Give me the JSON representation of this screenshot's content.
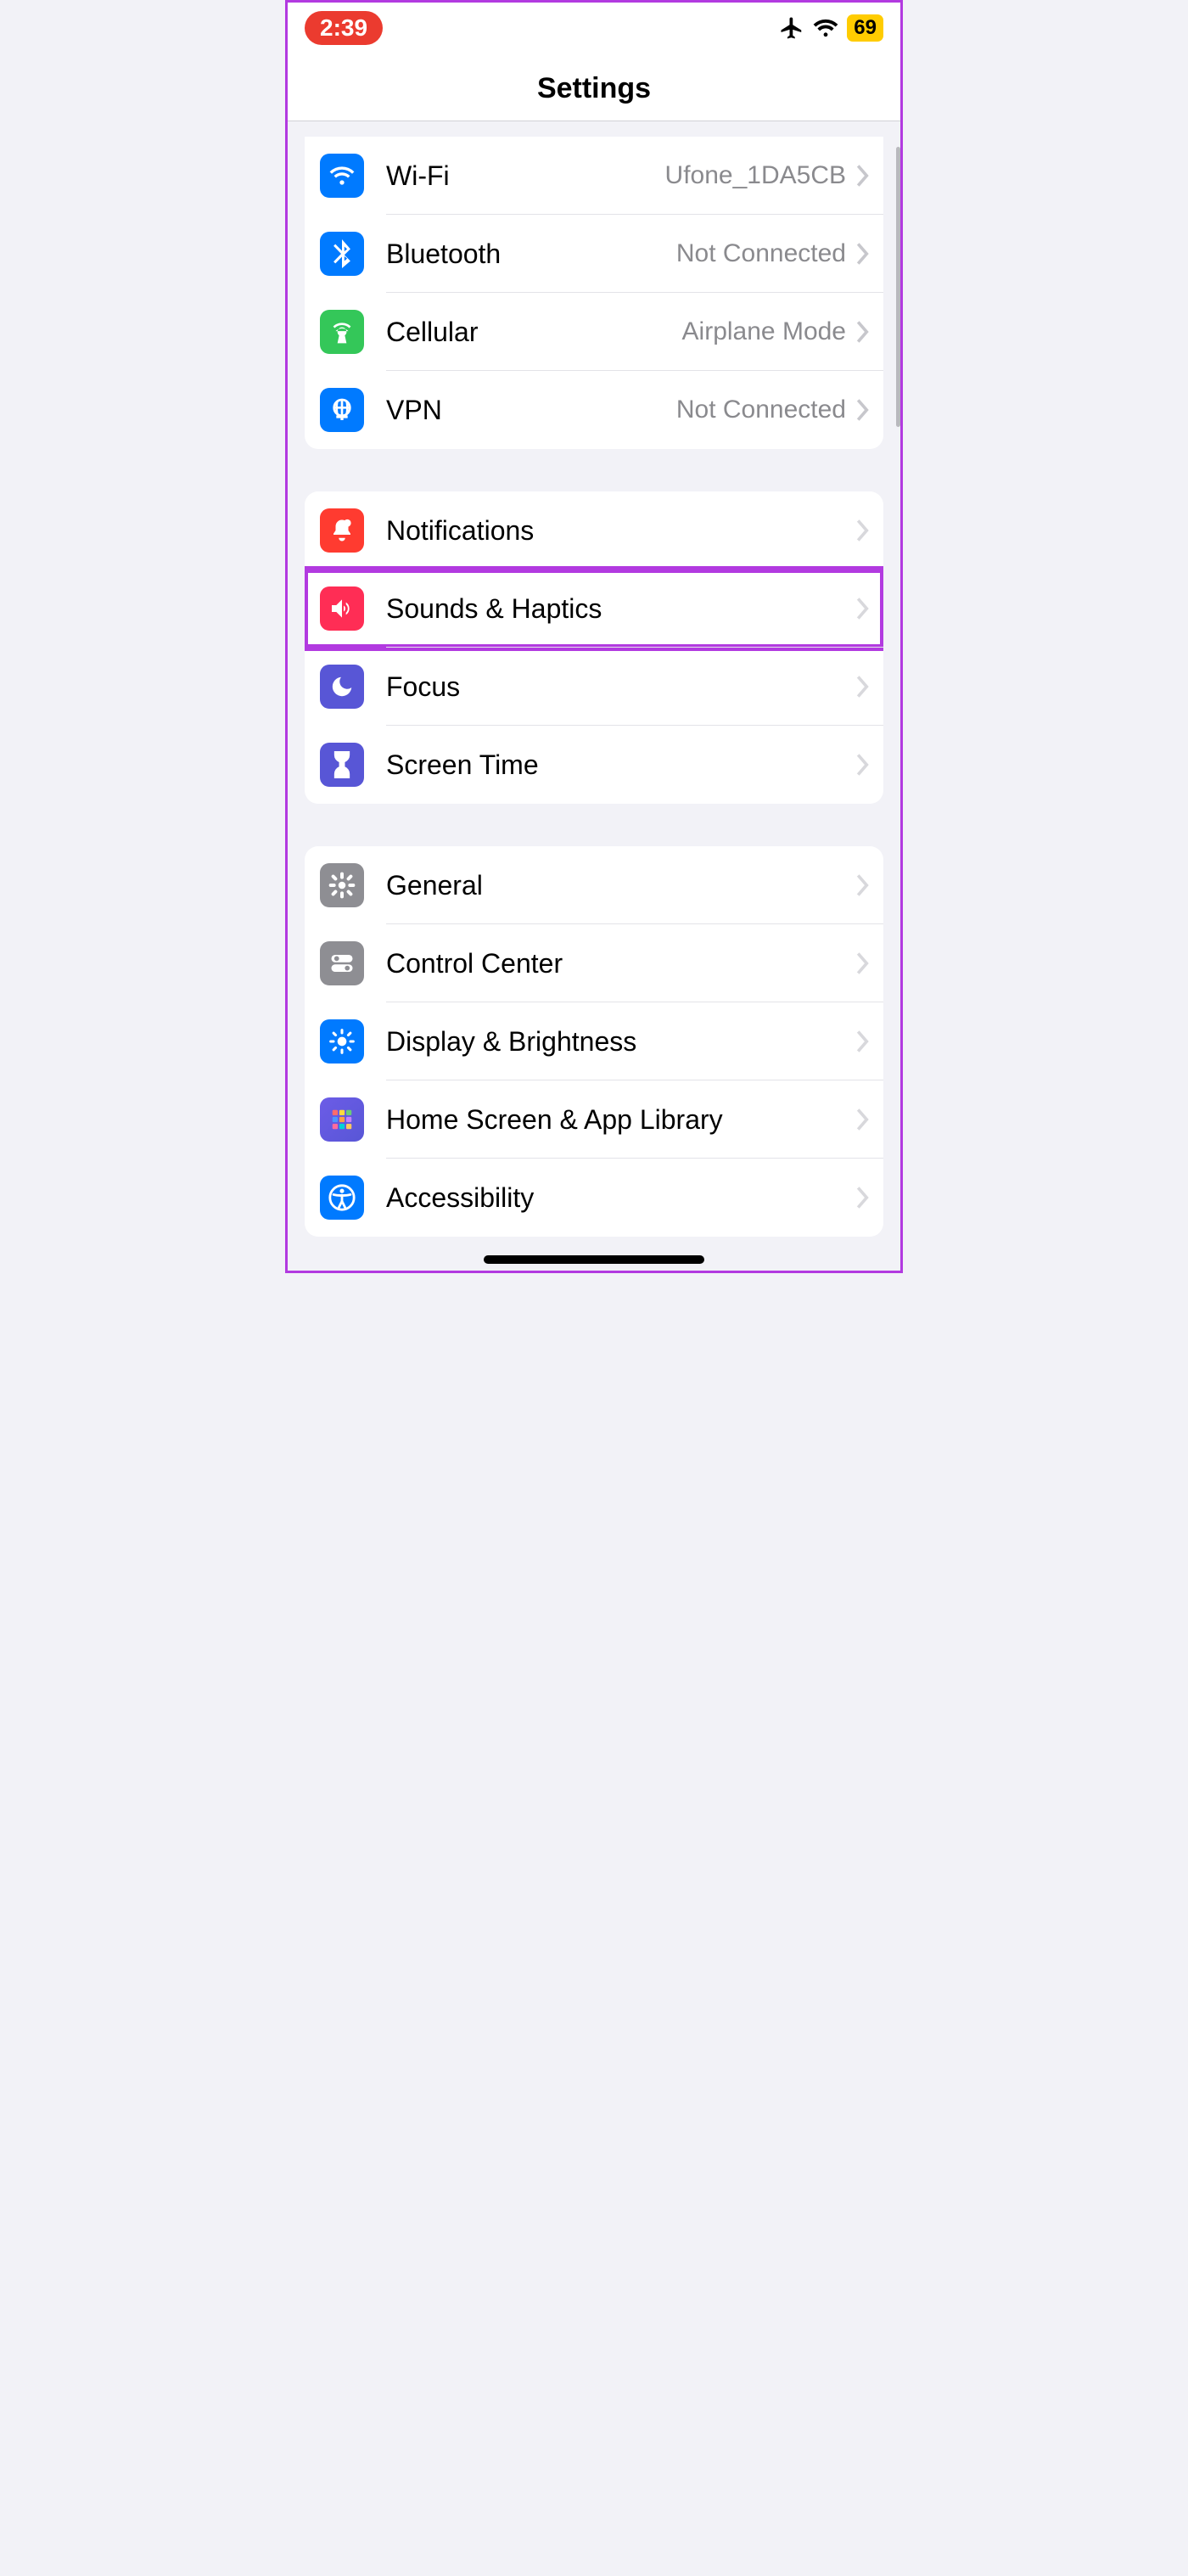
{
  "status": {
    "time": "2:39",
    "battery": "69"
  },
  "header": {
    "title": "Settings"
  },
  "groups": [
    {
      "rows": [
        {
          "label": "Wi-Fi",
          "value": "Ufone_1DA5CB"
        },
        {
          "label": "Bluetooth",
          "value": "Not Connected"
        },
        {
          "label": "Cellular",
          "value": "Airplane Mode"
        },
        {
          "label": "VPN",
          "value": "Not Connected"
        }
      ]
    },
    {
      "rows": [
        {
          "label": "Notifications"
        },
        {
          "label": "Sounds & Haptics"
        },
        {
          "label": "Focus"
        },
        {
          "label": "Screen Time"
        }
      ]
    },
    {
      "rows": [
        {
          "label": "General"
        },
        {
          "label": "Control Center"
        },
        {
          "label": "Display & Brightness"
        },
        {
          "label": "Home Screen & App Library"
        },
        {
          "label": "Accessibility"
        }
      ]
    }
  ]
}
